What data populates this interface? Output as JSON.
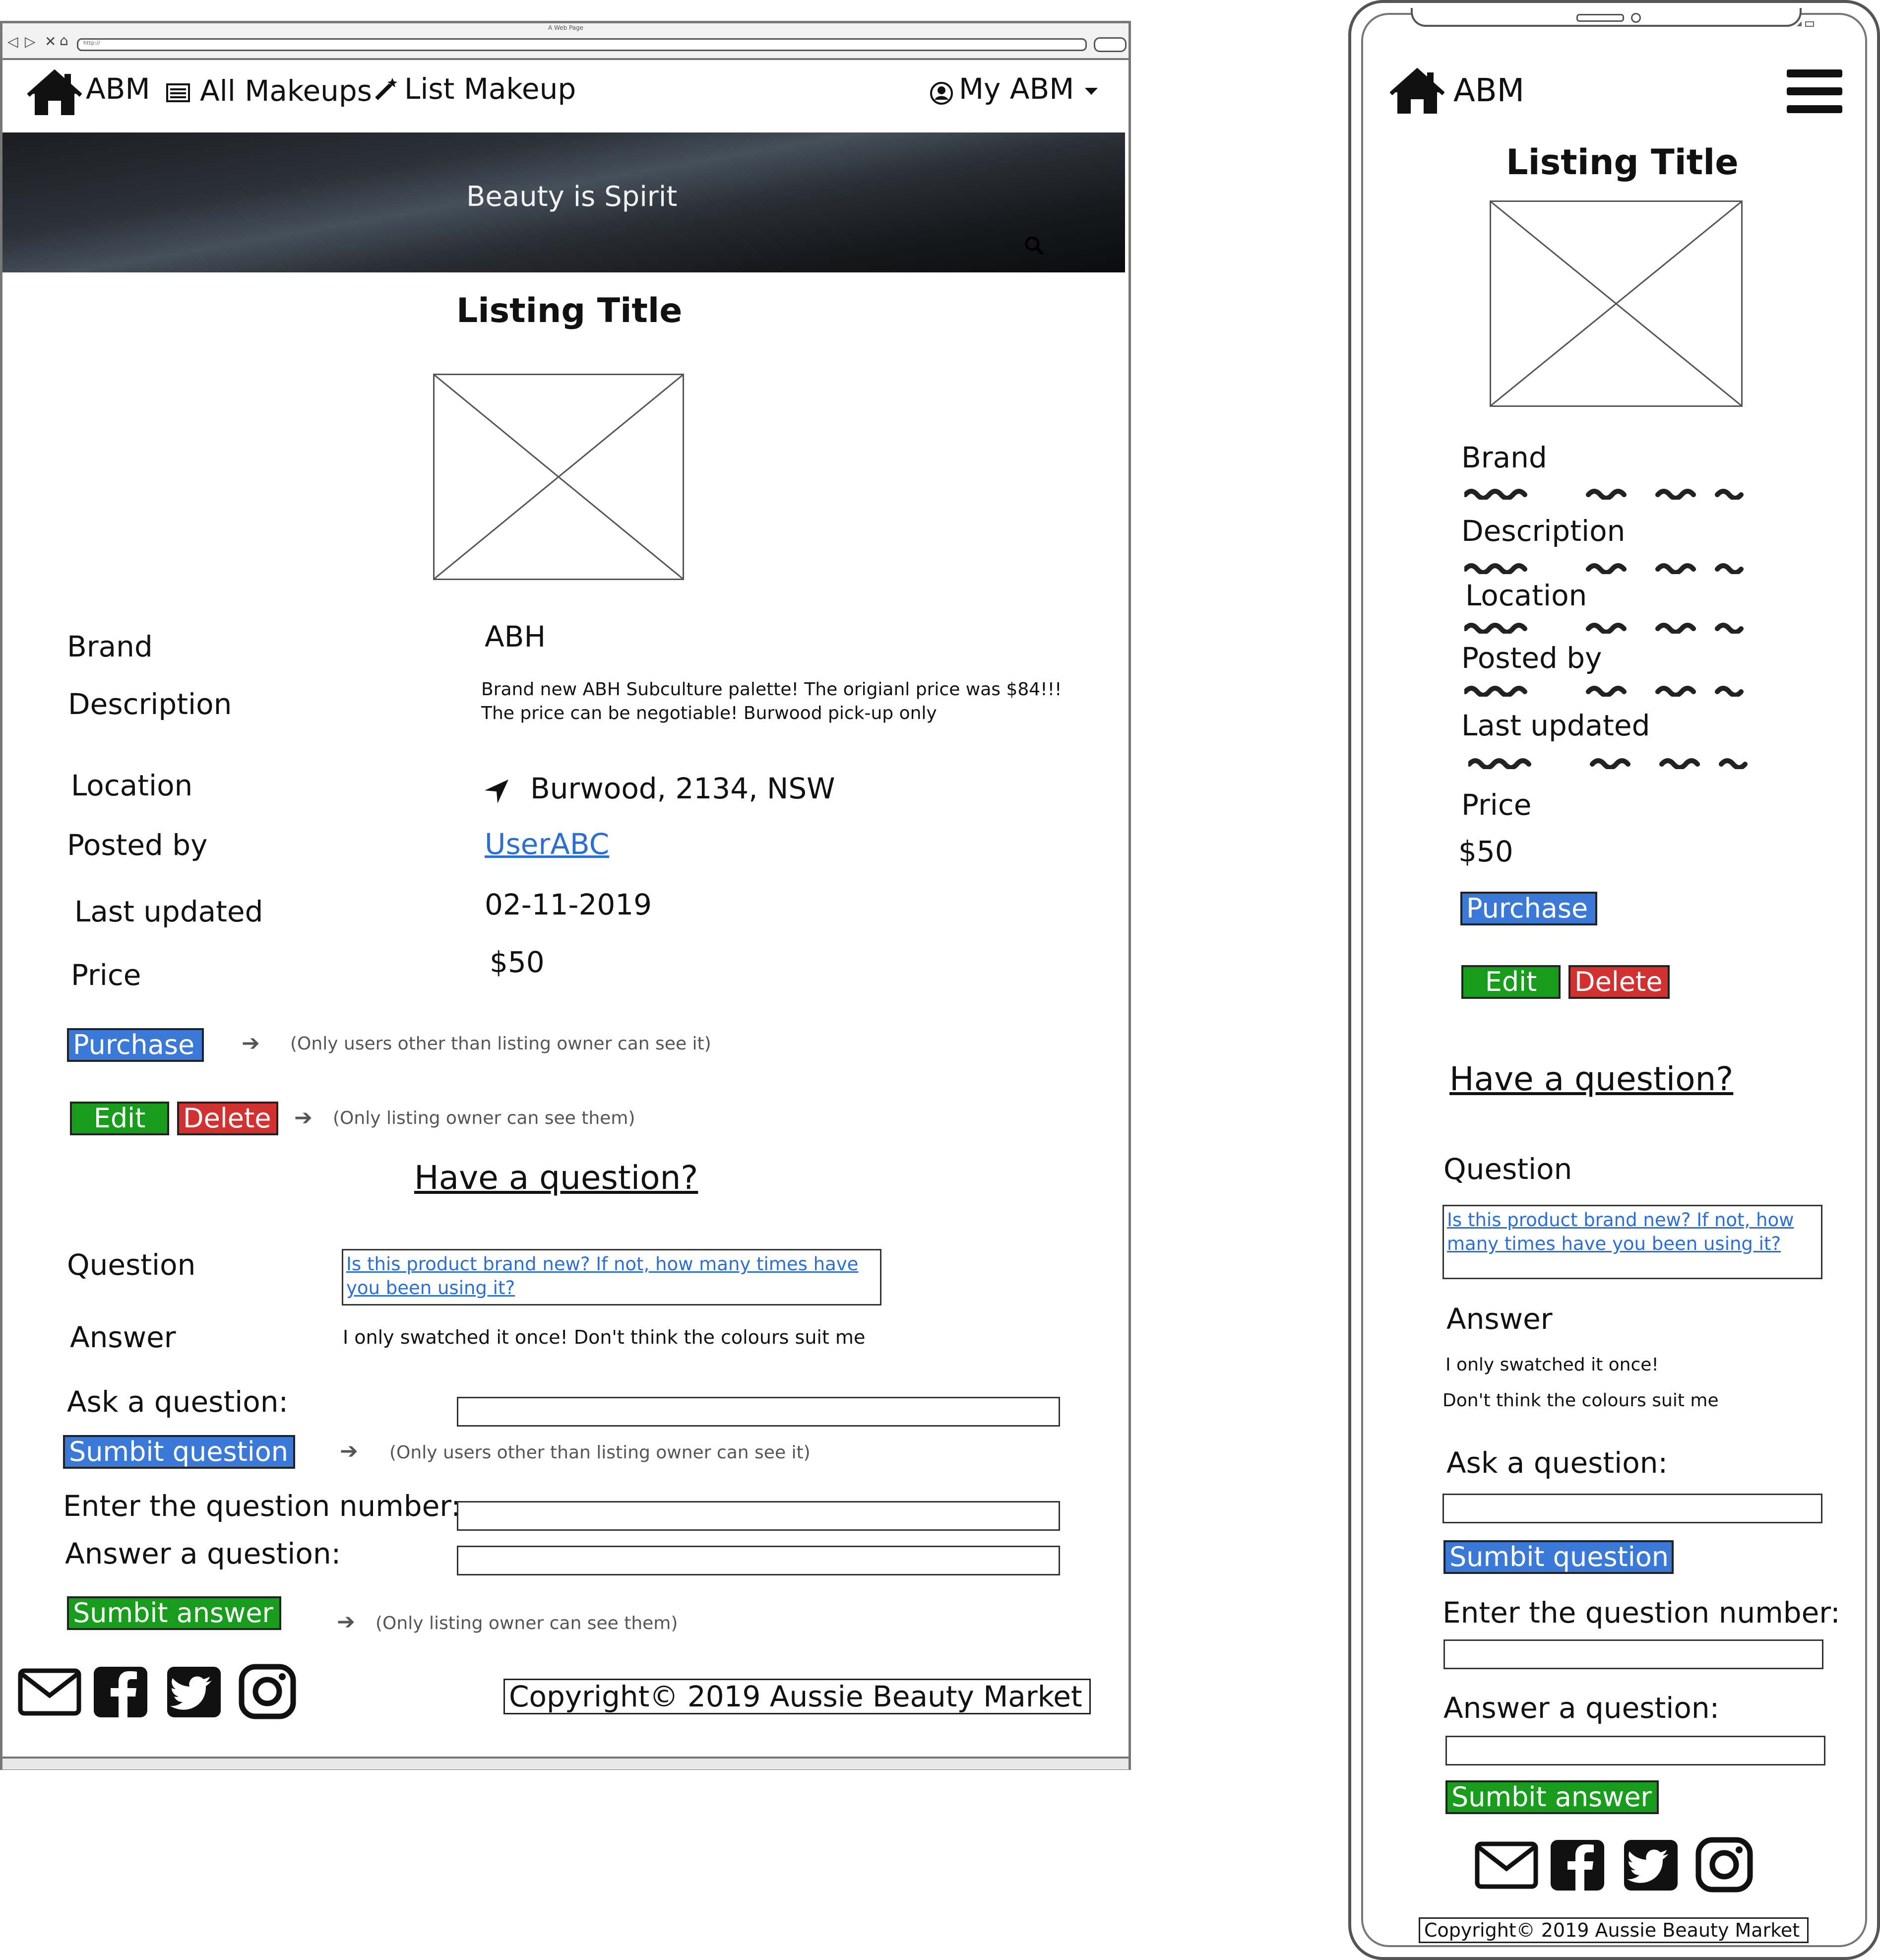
{
  "desktop": {
    "window": {
      "title": "A Web Page",
      "url": "http://"
    },
    "nav": {
      "brand": "ABM",
      "all_makeups": "All Makeups",
      "list_makeup": "List Makeup",
      "my_abm": "My ABM"
    },
    "hero": {
      "tagline": "Beauty is Spirit"
    },
    "listing": {
      "title": "Listing Title",
      "fields": {
        "brand_label": "Brand",
        "brand_value": "ABH",
        "description_label": "Description",
        "description_line1": "Brand new ABH Subculture palette! The origianl price was $84!!!",
        "description_line2": "The price can be negotiable! Burwood pick-up only",
        "location_label": "Location",
        "location_value": "Burwood, 2134, NSW",
        "posted_by_label": "Posted by",
        "posted_by_value": "UserABC",
        "last_updated_label": "Last updated",
        "last_updated_value": "02-11-2019",
        "price_label": "Price",
        "price_value": "$50"
      }
    },
    "actions": {
      "purchase": "Purchase",
      "purchase_note": "(Only users other than listing owner can see it)",
      "edit": "Edit",
      "delete": "Delete",
      "owner_note": "(Only listing owner can see them)"
    },
    "qa": {
      "heading": "Have a question?",
      "question_label": "Question",
      "question_line1": "Is this product brand new? If not, how many times have",
      "question_line2": "you been using it?",
      "answer_label": "Answer",
      "answer_text": "I only swatched it once! Don't think the colours suit me",
      "ask_label": "Ask a question:",
      "submit_question": "Sumbit question",
      "submit_question_note": "(Only users other than listing owner can see it)",
      "question_number_label": "Enter the question number:",
      "answer_question_label": "Answer a question:",
      "submit_answer": "Sumbit answer",
      "submit_answer_note": "(Only listing owner can see them)"
    },
    "footer": {
      "copyright": "Copyright© 2019 Aussie Beauty Market"
    },
    "icons": [
      "home-icon",
      "list-icon",
      "wand-icon",
      "user-circle-icon",
      "chevron-down-icon",
      "search-icon",
      "location-arrow-icon",
      "arrow-right-icon",
      "mail-icon",
      "facebook-icon",
      "twitter-icon",
      "instagram-icon"
    ]
  },
  "mobile": {
    "brand": "ABM",
    "title": "Listing Title",
    "labels": {
      "brand": "Brand",
      "description": "Description",
      "location": "Location",
      "posted_by": "Posted by",
      "last_updated": "Last updated",
      "price": "Price"
    },
    "price_value": "$50",
    "purchase": "Purchase",
    "edit": "Edit",
    "delete": "Delete",
    "qa": {
      "heading": "Have a question?",
      "question_label": "Question",
      "question_line1": "Is this product brand new? If not, how",
      "question_line2": "many times have you been using it?",
      "answer_label": "Answer",
      "answer_line1": "I only swatched it once!",
      "answer_line2": "Don't think the colours suit me",
      "ask_label": "Ask a question:",
      "submit_question": "Sumbit question",
      "question_number_label": "Enter the question number:",
      "answer_question_label": "Answer a question:",
      "submit_answer": "Sumbit answer"
    },
    "footer": {
      "copyright": "Copyright© 2019 Aussie Beauty Market"
    },
    "icons": [
      "home-icon",
      "hamburger-menu-icon",
      "mail-icon",
      "facebook-icon",
      "twitter-icon",
      "instagram-icon"
    ]
  },
  "colors": {
    "link": "#2a6fd6",
    "purchase": "#3a79d8",
    "edit": "#179c1c",
    "delete": "#d33030"
  }
}
